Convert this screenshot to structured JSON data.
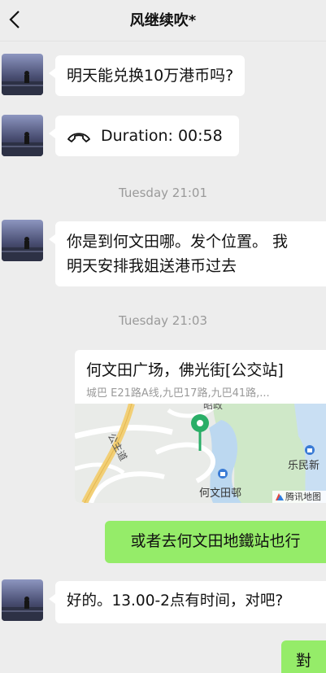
{
  "header": {
    "title": "风继续吹*",
    "back_icon": "chevron-left-icon"
  },
  "messages": [
    {
      "sender": "other",
      "type": "text",
      "text": "明天能兑换10万港币吗?"
    },
    {
      "sender": "other",
      "type": "call",
      "icon": "phone-hangup-icon",
      "text": "Duration: 00:58"
    },
    {
      "type": "timestamp",
      "text": "Tuesday 21:01"
    },
    {
      "sender": "other",
      "type": "text",
      "lines": [
        "你是到何文田哪。发个位置。 我",
        "明天安排我姐送港币过去"
      ]
    },
    {
      "type": "timestamp",
      "text": "Tuesday 21:03"
    },
    {
      "sender": "other",
      "type": "location",
      "name": "何文田广场，佛光街[公交站]",
      "address": "城巴 E21路A线,九巴17路,九巴41路,...",
      "map_labels": {
        "place": "何文田邨",
        "street": "公主道",
        "road_top": "昭政",
        "area": "乐民新",
        "brand": "腾讯地图"
      }
    },
    {
      "sender": "me",
      "type": "text",
      "text": "或者去何文田地鐵站也行"
    },
    {
      "sender": "other",
      "type": "text",
      "text": "好的。13.00-2点有时间，对吧?"
    },
    {
      "sender": "me",
      "type": "text",
      "text": "對"
    }
  ],
  "colors": {
    "background": "#ededed",
    "my_bubble": "#95ec69",
    "their_bubble": "#ffffff",
    "map_pin": "#2aae67"
  }
}
